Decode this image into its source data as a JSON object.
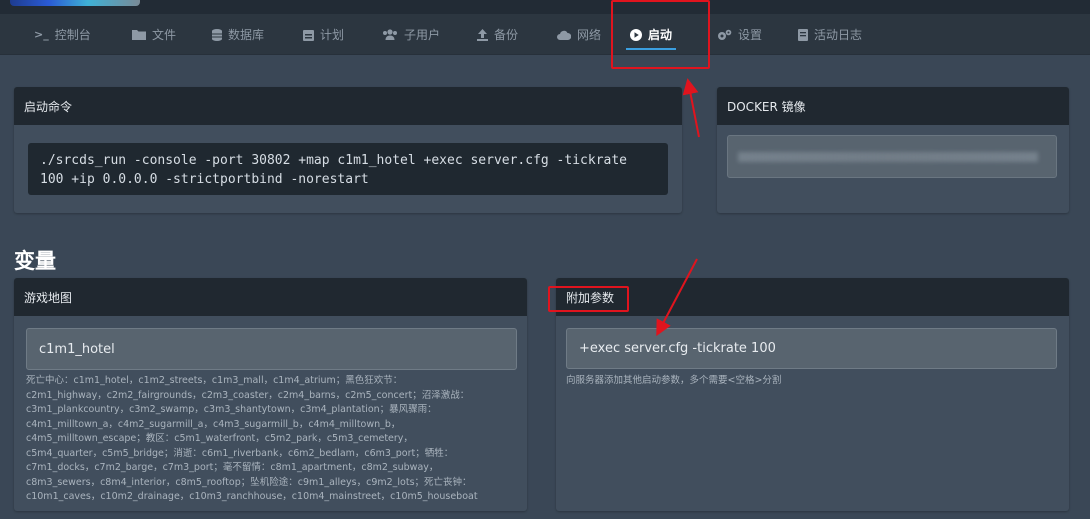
{
  "nav": {
    "items": [
      {
        "label": "控制台",
        "icon": "terminal-icon",
        "glyph": ">_",
        "active": false
      },
      {
        "label": "文件",
        "icon": "folder-icon",
        "glyph": "▬",
        "active": false
      },
      {
        "label": "数据库",
        "icon": "database-icon",
        "glyph": "≡",
        "active": false
      },
      {
        "label": "计划",
        "icon": "calendar-icon",
        "glyph": "▤",
        "active": false
      },
      {
        "label": "子用户",
        "icon": "users-icon",
        "glyph": "👥",
        "active": false
      },
      {
        "label": "备份",
        "icon": "upload-icon",
        "glyph": "⬆",
        "active": false
      },
      {
        "label": "网络",
        "icon": "cloud-icon",
        "glyph": "☁",
        "active": false
      },
      {
        "label": "启动",
        "icon": "play-circle-icon",
        "glyph": "▶",
        "active": true
      },
      {
        "label": "设置",
        "icon": "cogs-icon",
        "glyph": "⚙",
        "active": false
      },
      {
        "label": "活动日志",
        "icon": "log-icon",
        "glyph": "▤",
        "active": false
      }
    ],
    "active_color": "#3b9fe0"
  },
  "startup": {
    "title": "启动命令",
    "command": "./srcds_run -console -port 30802 +map c1m1_hotel +exec server.cfg -tickrate\n100 +ip 0.0.0.0 -strictportbind -norestart"
  },
  "docker": {
    "title": "DOCKER 镜像"
  },
  "variables": {
    "title": "变量",
    "game_map": {
      "title": "游戏地图",
      "value": "c1m1_hotel",
      "help": "死亡中心：c1m1_hotel，c1m2_streets，c1m3_mall，c1m4_atrium；黑色狂欢节：\nc2m1_highway，c2m2_fairgrounds，c2m3_coaster，c2m4_barns，c2m5_concert；沼泽激战：\nc3m1_plankcountry，c3m2_swamp，c3m3_shantytown，c3m4_plantation；暴风骤雨：\nc4m1_milltown_a，c4m2_sugarmill_a，c4m3_sugarmill_b，c4m4_milltown_b，\nc4m5_milltown_escape；教区：c5m1_waterfront，c5m2_park，c5m3_cemetery，\nc5m4_quarter，c5m5_bridge；消逝：c6m1_riverbank，c6m2_bedlam，c6m3_port；牺牲：\nc7m1_docks，c7m2_barge，c7m3_port；毫不留情：c8m1_apartment，c8m2_subway，\nc8m3_sewers，c8m4_interior，c8m5_rooftop；坠机险途：c9m1_alleys，c9m2_lots；死亡丧钟：\nc10m1_caves，c10m2_drainage，c10m3_ranchhouse，c10m4_mainstreet，c10m5_houseboat"
    },
    "extra_params": {
      "title": "附加参数",
      "value": "+exec server.cfg -tickrate 100",
      "help": "向服务器添加其他启动参数，多个需要<空格>分割"
    }
  },
  "annotation_color": "#e0141e"
}
